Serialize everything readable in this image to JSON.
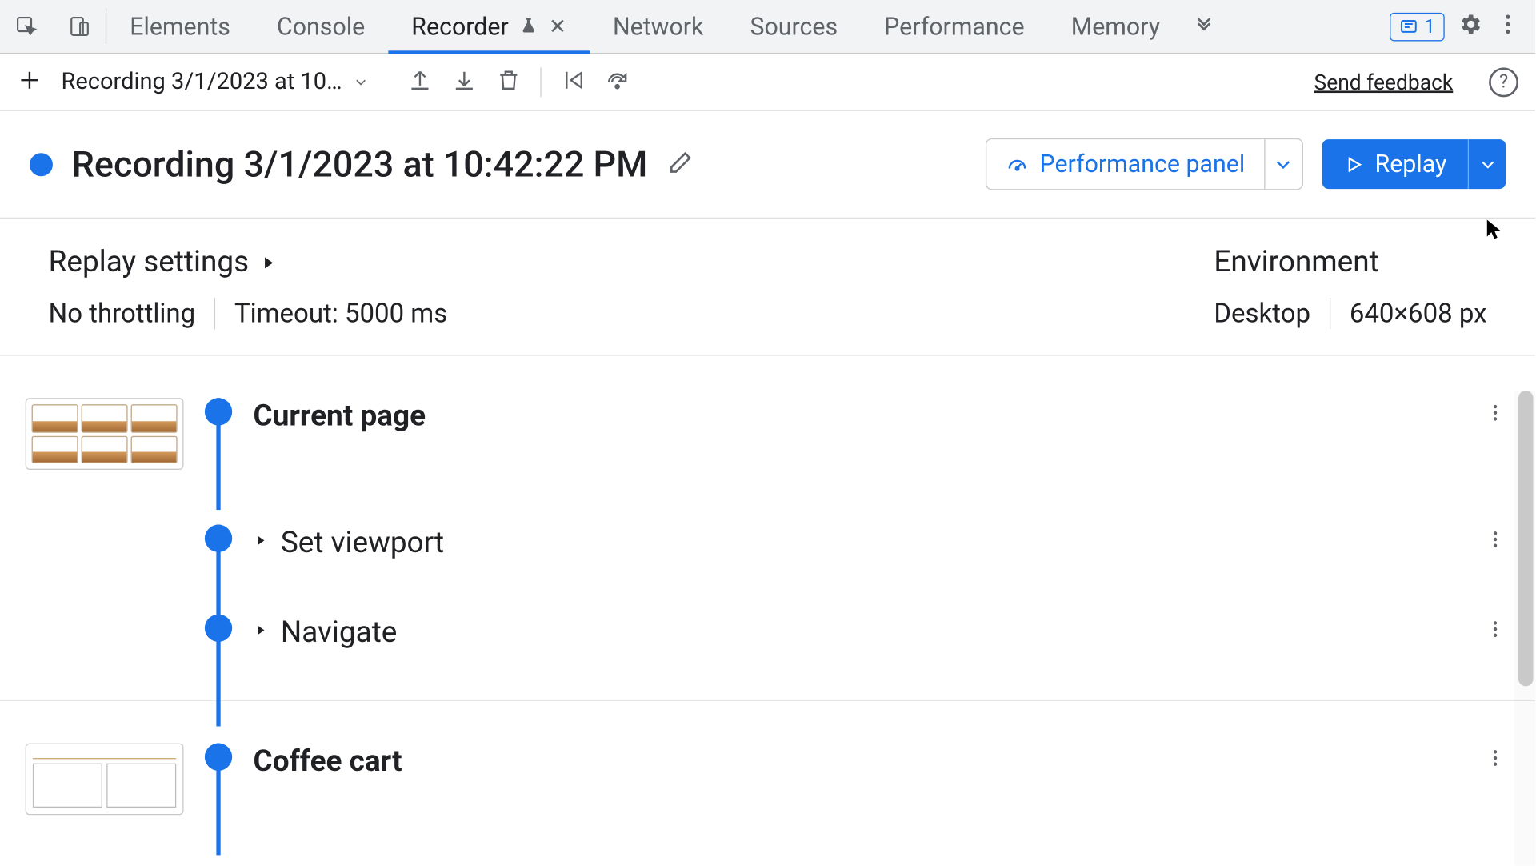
{
  "tabs": {
    "elements": "Elements",
    "console": "Console",
    "recorder": "Recorder",
    "network": "Network",
    "sources": "Sources",
    "performance": "Performance",
    "memory": "Memory"
  },
  "issues_count": "1",
  "toolbar": {
    "recording_select": "Recording 3/1/2023 at 10…",
    "feedback": "Send feedback"
  },
  "header": {
    "title": "Recording 3/1/2023 at 10:42:22 PM",
    "perf_panel": "Performance panel",
    "replay": "Replay"
  },
  "settings": {
    "label": "Replay settings",
    "throttling": "No throttling",
    "timeout": "Timeout: 5000 ms"
  },
  "environment": {
    "label": "Environment",
    "device": "Desktop",
    "viewport": "640×608 px"
  },
  "steps": {
    "current_page": "Current page",
    "set_viewport": "Set viewport",
    "navigate": "Navigate",
    "coffee_cart": "Coffee cart"
  }
}
